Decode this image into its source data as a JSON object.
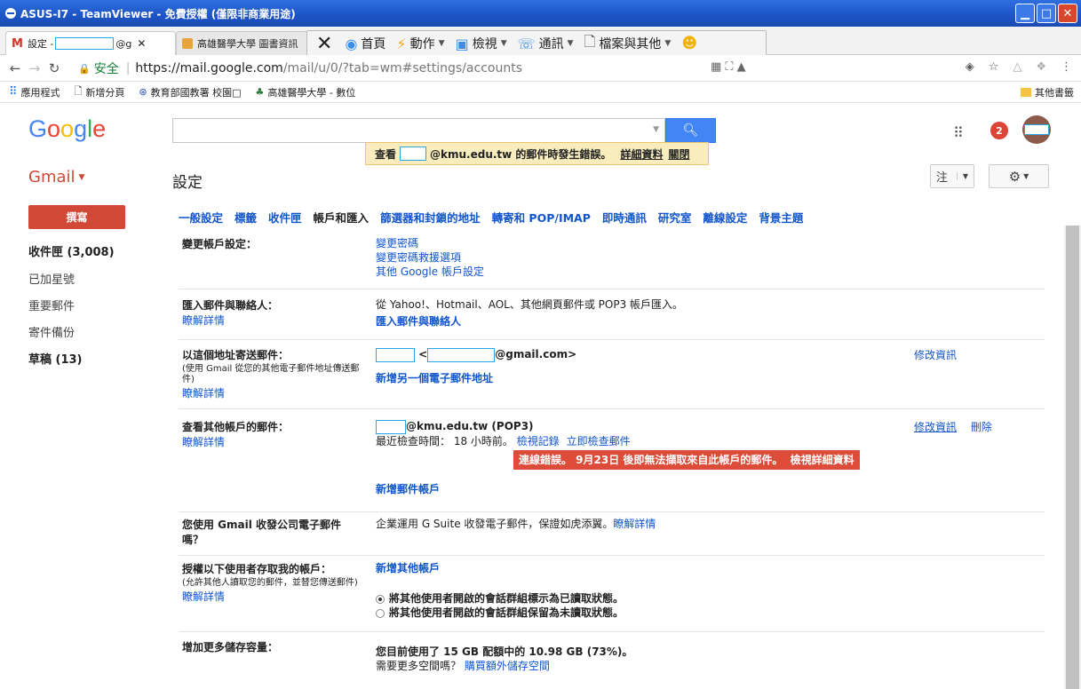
{
  "teamviewer": {
    "title": "ASUS-I7 - TeamViewer - 免費授權 (僅限非商業用途)",
    "toolbar": {
      "close": "✕",
      "home": "首頁",
      "actions": "動作",
      "view": "檢視",
      "communicate": "通訊",
      "files": "檔案與其他"
    }
  },
  "browser": {
    "tab1_prefix": "設定 -",
    "tab1_suffix": "@g",
    "tab2": "高雄醫學大學 圖書資訊",
    "secure_label": "安全",
    "url_host": "https://mail.google.com",
    "url_path": "/mail/u/0/?tab=wm#settings/accounts",
    "bookmarks": [
      "應用程式",
      "新增分頁",
      "教育部國教署 校園□",
      "高雄醫學大學 - 數位"
    ],
    "other_bookmarks": "其他書籤"
  },
  "gmail": {
    "logo_letters": [
      "G",
      "o",
      "o",
      "g",
      "l",
      "e"
    ],
    "notification_count": "2",
    "error_toast": {
      "prefix": "查看",
      "suffix": "@kmu.edu.tw 的郵件時發生錯誤。",
      "details": "詳細資料",
      "close": "關閉"
    },
    "app_label": "Gmail",
    "page_title": "設定",
    "input_tools": "注",
    "compose": "撰寫",
    "nav": {
      "inbox": "收件匣 (3,008)",
      "starred": "已加星號",
      "important": "重要郵件",
      "sent": "寄件備份",
      "drafts": "草稿 (13)"
    },
    "settings_tabs": [
      "一般設定",
      "標籤",
      "收件匣",
      "帳戶和匯入",
      "篩選器和封鎖的地址",
      "轉寄和 POP/IMAP",
      "即時通訊",
      "研究室",
      "離線設定",
      "背景主題"
    ],
    "rows": {
      "change_account": {
        "label": "變更帳戶設定：",
        "links": [
          "變更密碼",
          "變更密碼救援選項",
          "其他 Google 帳戶設定"
        ]
      },
      "import": {
        "label": "匯入郵件與聯絡人：",
        "help": "瞭解詳情",
        "text": "從 Yahoo!、Hotmail、AOL、其他網頁郵件或 POP3 帳戶匯入。",
        "link": "匯入郵件與聯絡人"
      },
      "send_as": {
        "label": "以這個地址寄送郵件：",
        "sub": "(使用 Gmail 從您的其他電子郵件地址傳送郵件)",
        "help": "瞭解詳情",
        "address_suffix": "@gmail.com>",
        "add_link": "新增另一個電子郵件地址",
        "edit": "修改資訊"
      },
      "check_mail": {
        "label": "查看其他帳戶的郵件：",
        "help": "瞭解詳情",
        "account_suffix": "@kmu.edu.tw (POP3)",
        "last_checked": "最近檢查時間： 18 小時前。",
        "history_link": "檢視記錄",
        "check_now_link": "立即檢查郵件",
        "alert": "連線錯誤。 9月23日 後即無法擷取來自此帳戶的郵件。",
        "alert_link": "檢視詳細資料",
        "add_account": "新增郵件帳戶",
        "edit": "修改資訊",
        "delete": "刪除"
      },
      "business": {
        "label": "您使用 Gmail 收發公司電子郵件嗎？",
        "text": "企業運用 G Suite 收發電子郵件，保證如虎添翼。",
        "link": "瞭解詳情"
      },
      "delegate": {
        "label": "授權以下使用者存取我的帳戶：",
        "sub": "(允許其他人讀取您的郵件，並替您傳送郵件)",
        "help": "瞭解詳情",
        "add_link": "新增其他帳戶",
        "option1": "將其他使用者開啟的會話群組標示為已讀取狀態。",
        "option2": "將其他使用者開啟的會話群組保留為未讀取狀態。"
      },
      "storage": {
        "label": "增加更多儲存容量：",
        "usage": "您目前使用了 15 GB 配額中的 10.98 GB (73%)。",
        "need_more": "需要更多空間嗎？",
        "buy_link": "購買額外儲存空間"
      }
    }
  }
}
